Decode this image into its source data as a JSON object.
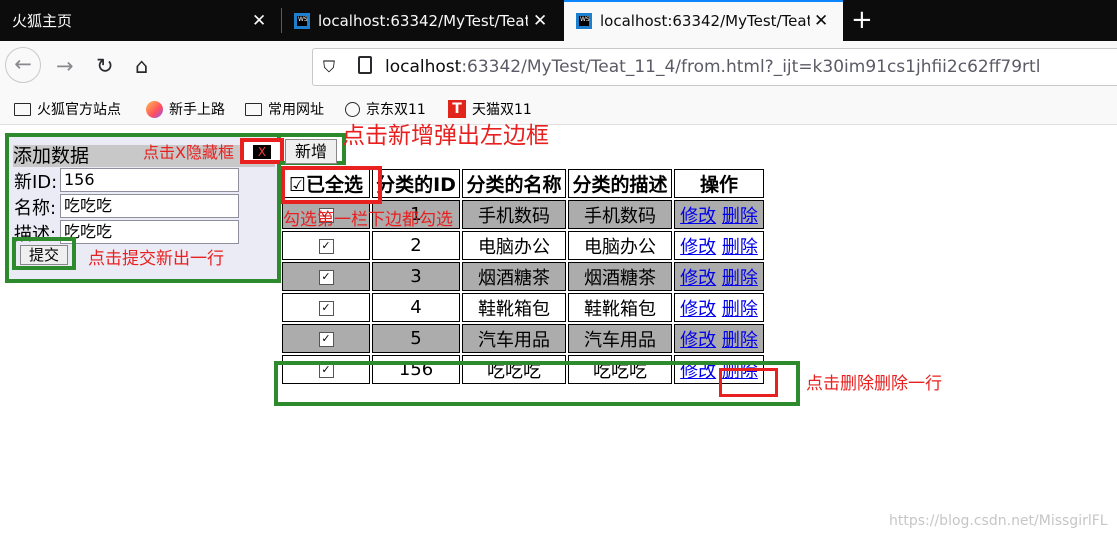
{
  "tabs": [
    {
      "title": "火狐主页"
    },
    {
      "title": "localhost:63342/MyTest/Teat"
    },
    {
      "title": "localhost:63342/MyTest/Teat"
    }
  ],
  "url": {
    "host": "localhost",
    "rest": ":63342/MyTest/Teat_11_4/from.html?_ijt=k30im91cs1jhfii2c62ff79rtl"
  },
  "bookmarks": [
    "火狐官方站点",
    "新手上路",
    "常用网址",
    "京东双11",
    "天猫双11"
  ],
  "form": {
    "title": "添加数据",
    "close_label": "X",
    "id_label": "新ID:",
    "id_value": "156",
    "name_label": "名称:",
    "name_value": "吃吃吃",
    "desc_label": "描述:",
    "desc_value": "吃吃吃",
    "submit_label": "提交"
  },
  "add_button": "新增",
  "annotations": {
    "hide": "点击X隐藏框",
    "add": "点击新增弹出左边框",
    "check": "勾选第一栏下边都勾选",
    "submit": "点击提交新出一行",
    "delete": "点击删除删除一行"
  },
  "table": {
    "headers": [
      "☑已全选",
      "分类的ID",
      "分类的名称",
      "分类的描述",
      "操作"
    ],
    "rows": [
      {
        "id": "1",
        "name": "手机数码",
        "desc": "手机数码"
      },
      {
        "id": "2",
        "name": "电脑办公",
        "desc": "电脑办公"
      },
      {
        "id": "3",
        "name": "烟酒糖茶",
        "desc": "烟酒糖茶"
      },
      {
        "id": "4",
        "name": "鞋靴箱包",
        "desc": "鞋靴箱包"
      },
      {
        "id": "5",
        "name": "汽车用品",
        "desc": "汽车用品"
      },
      {
        "id": "156",
        "name": "吃吃吃",
        "desc": "吃吃吃"
      }
    ],
    "edit_label": "修改",
    "delete_label": "删除"
  },
  "watermark": "https://blog.csdn.net/MissgirlFL",
  "colors": {
    "annotation_red": "#e82020",
    "highlight_green": "#2d8a2d",
    "row_gray": "#acacac"
  }
}
